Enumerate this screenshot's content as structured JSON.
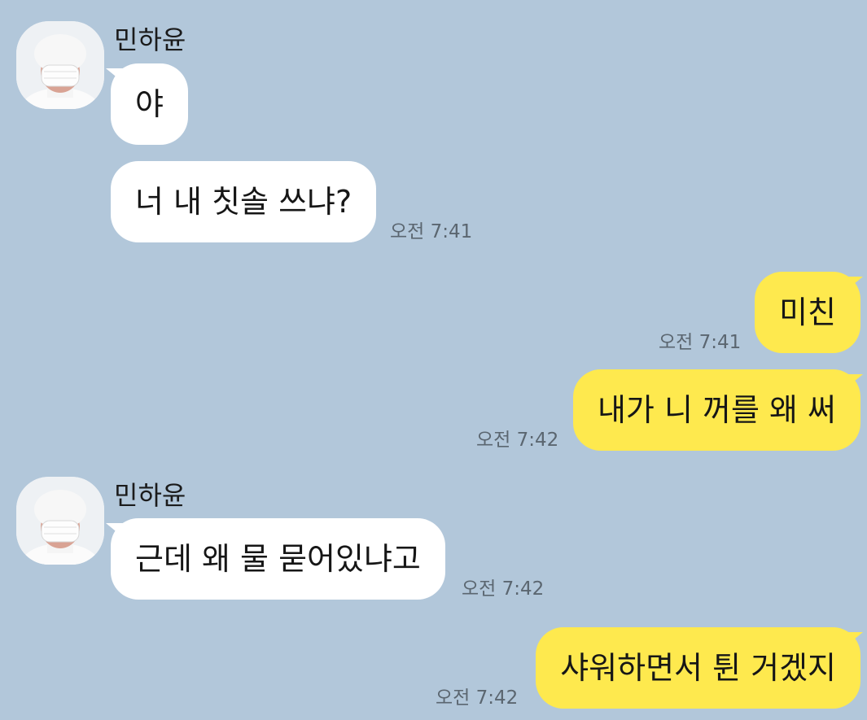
{
  "chat": {
    "messages": [
      {
        "sender": "민하윤",
        "direction": "in",
        "text": "야",
        "time": ""
      },
      {
        "sender": "",
        "direction": "in",
        "text": "너 내 칫솔 쓰냐?",
        "time": "오전 7:41"
      },
      {
        "sender": "",
        "direction": "out",
        "text": "미친",
        "time": "오전 7:41"
      },
      {
        "sender": "",
        "direction": "out",
        "text": "내가 니 꺼를 왜 써",
        "time": "오전 7:42"
      },
      {
        "sender": "민하윤",
        "direction": "in",
        "text": "근데 왜 물 묻어있냐고",
        "time": "오전 7:42"
      },
      {
        "sender": "",
        "direction": "out",
        "text": "샤워하면서 튄 거겠지",
        "time": "오전 7:42"
      }
    ]
  },
  "colors": {
    "background": "#b2c7da",
    "incoming_bubble": "#ffffff",
    "outgoing_bubble": "#fee94e",
    "timestamp": "#5b6670"
  },
  "icons": {
    "avatar": "profile-photo-person-in-white-hood-and-mask"
  }
}
